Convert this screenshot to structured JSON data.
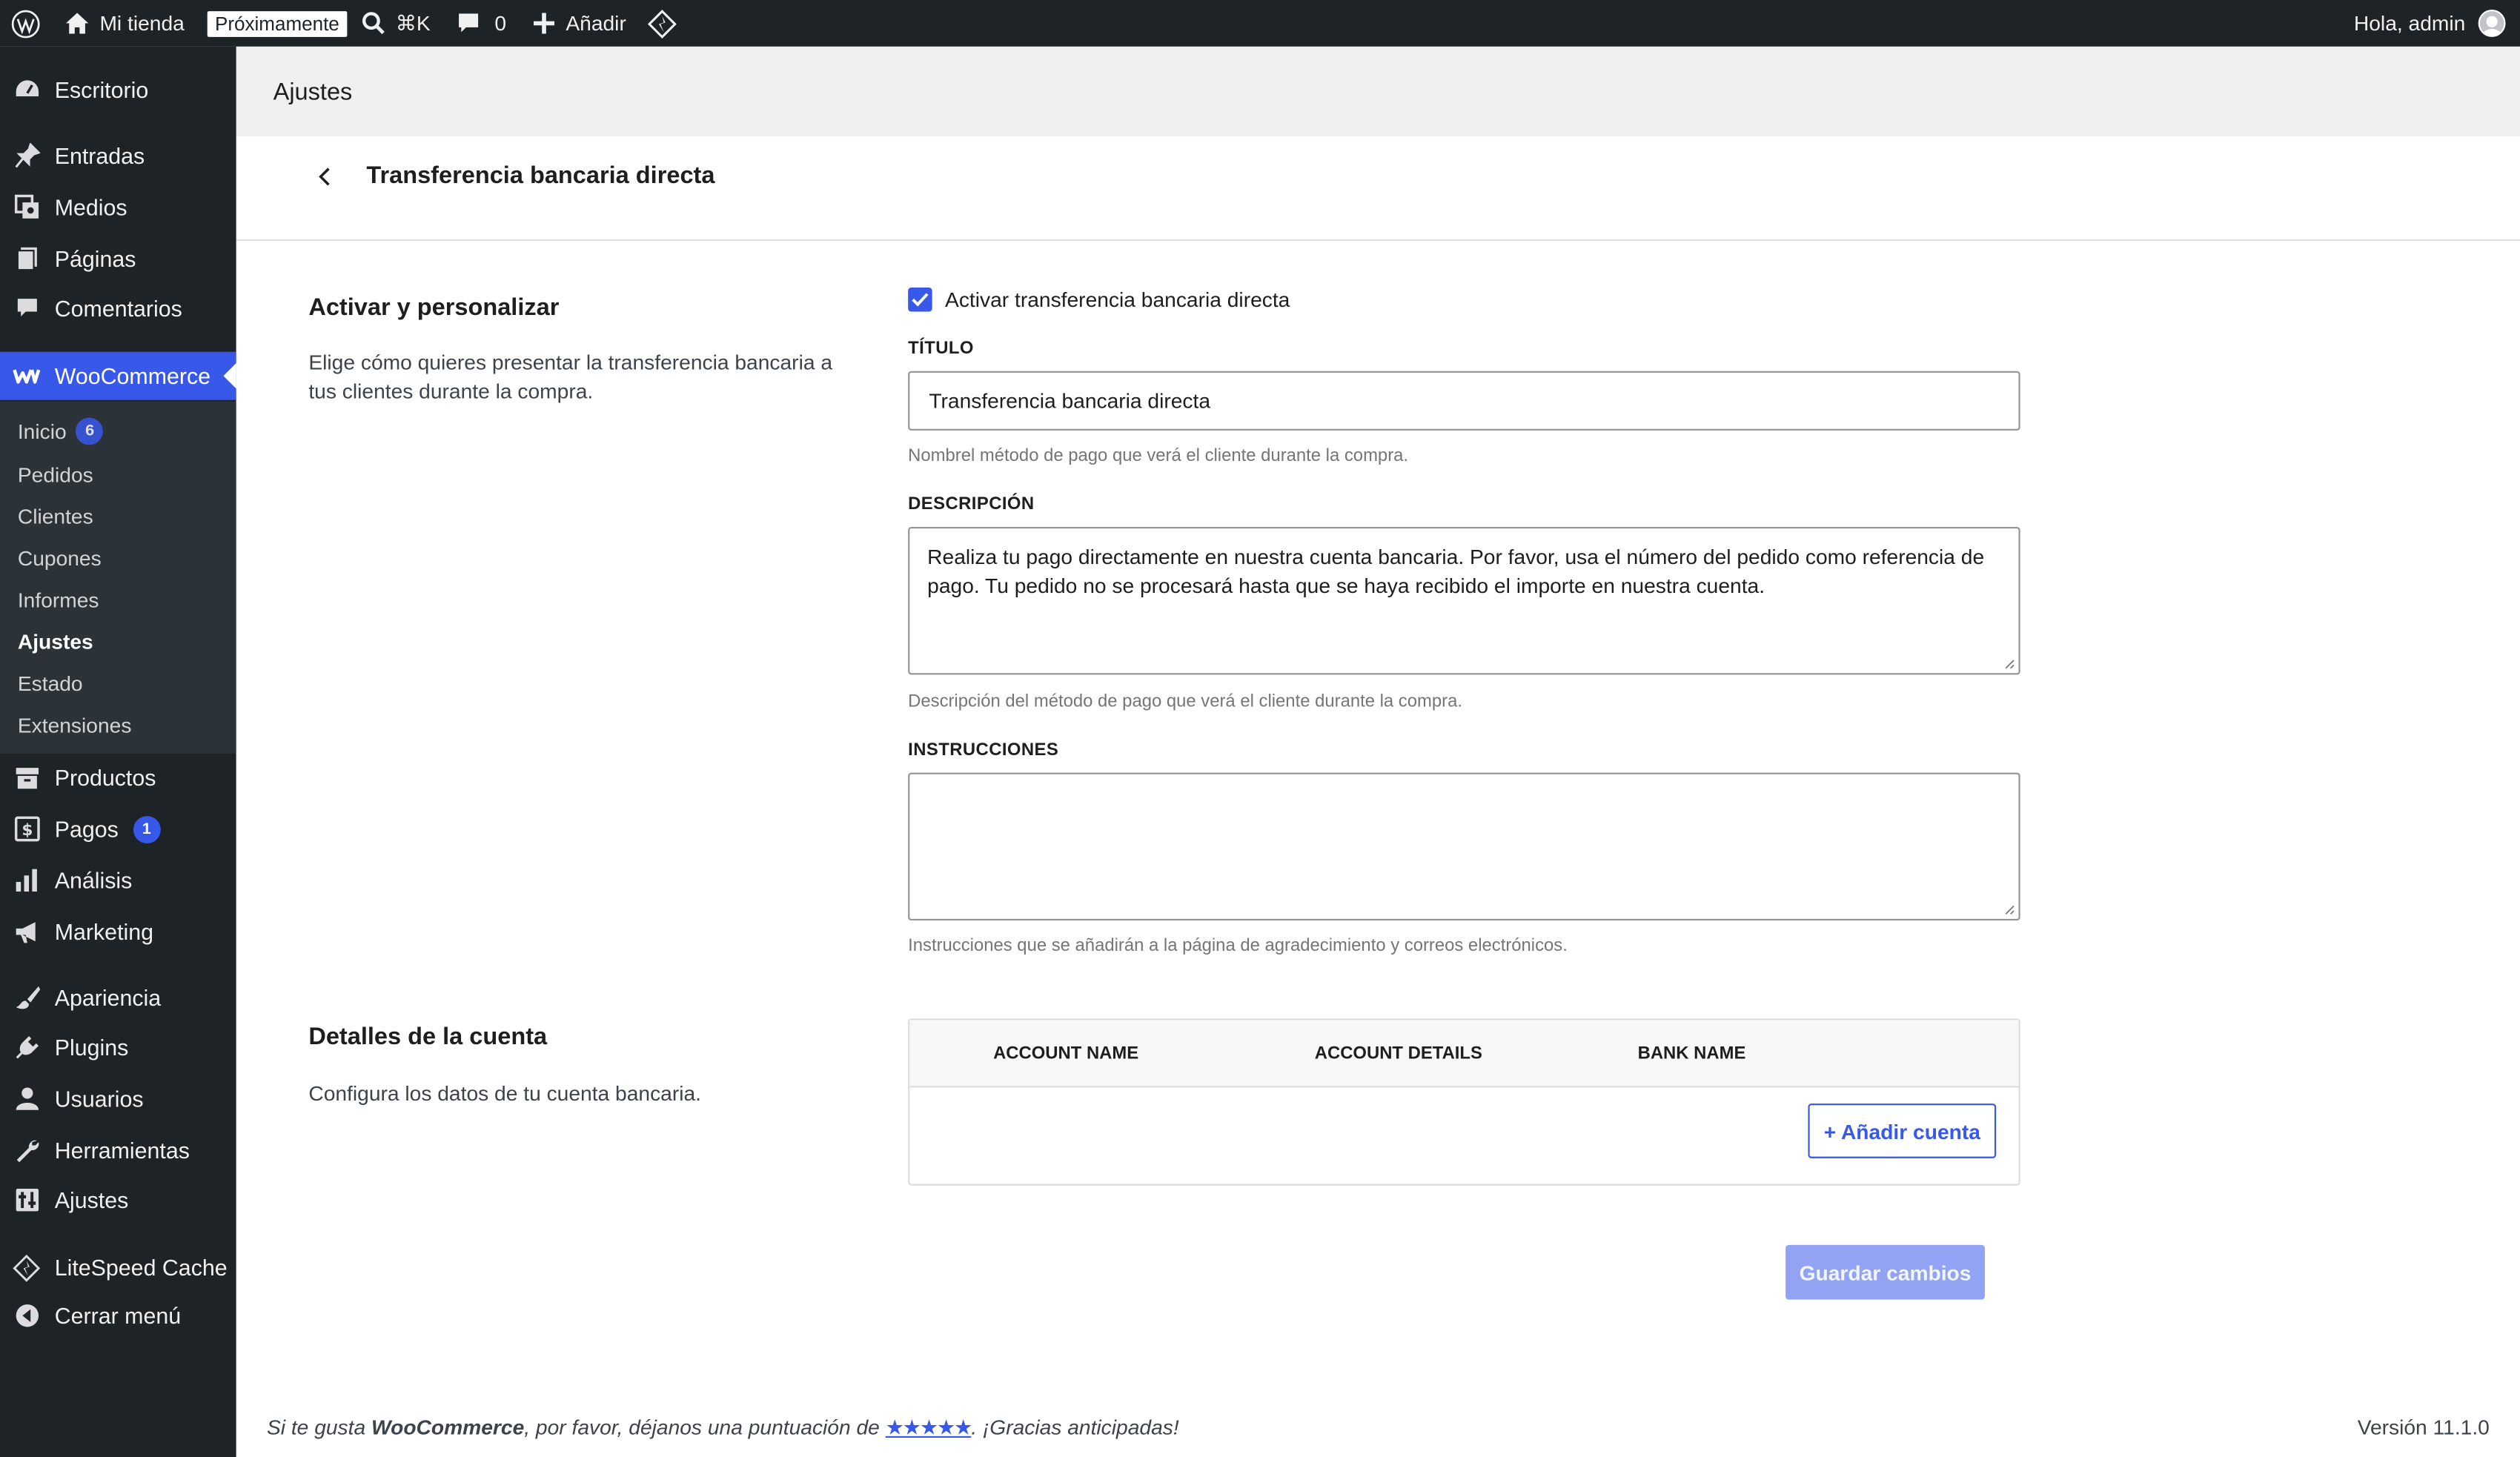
{
  "adminbar": {
    "site_name": "Mi tienda",
    "badge": "Próximamente",
    "search_shortcut": "⌘K",
    "comments_count": "0",
    "new_label": "Añadir",
    "greeting": "Hola, admin"
  },
  "sidebar": {
    "items": [
      {
        "label": "Escritorio",
        "icon": "dashboard-icon"
      },
      {
        "label": "Entradas",
        "icon": "pin-icon"
      },
      {
        "label": "Medios",
        "icon": "media-icon"
      },
      {
        "label": "Páginas",
        "icon": "pages-icon"
      },
      {
        "label": "Comentarios",
        "icon": "comments-icon"
      },
      {
        "label": "WooCommerce",
        "icon": "woocommerce-icon"
      },
      {
        "label": "Productos",
        "icon": "products-icon"
      },
      {
        "label": "Pagos",
        "icon": "payments-icon",
        "badge": "1"
      },
      {
        "label": "Análisis",
        "icon": "analytics-icon"
      },
      {
        "label": "Marketing",
        "icon": "megaphone-icon"
      },
      {
        "label": "Apariencia",
        "icon": "brush-icon"
      },
      {
        "label": "Plugins",
        "icon": "plugin-icon"
      },
      {
        "label": "Usuarios",
        "icon": "users-icon"
      },
      {
        "label": "Herramientas",
        "icon": "wrench-icon"
      },
      {
        "label": "Ajustes",
        "icon": "settings-icon"
      },
      {
        "label": "LiteSpeed Cache",
        "icon": "litespeed-icon"
      },
      {
        "label": "Cerrar menú",
        "icon": "collapse-icon"
      }
    ],
    "submenu": [
      {
        "label": "Inicio",
        "badge": "6"
      },
      {
        "label": "Pedidos"
      },
      {
        "label": "Clientes"
      },
      {
        "label": "Cupones"
      },
      {
        "label": "Informes"
      },
      {
        "label": "Ajustes",
        "current": true
      },
      {
        "label": "Estado"
      },
      {
        "label": "Extensiones"
      }
    ]
  },
  "header": {
    "title": "Ajustes",
    "subtitle": "Transferencia bancaria directa"
  },
  "section1": {
    "title": "Activar y personalizar",
    "description": "Elige cómo quieres presentar la transferencia bancaria a tus clientes durante la compra.",
    "enable_label": "Activar transferencia bancaria directa",
    "enabled": true,
    "title_label": "TÍTULO",
    "title_value": "Transferencia bancaria directa",
    "title_help": "Nombrel método de pago que verá el cliente durante la compra.",
    "desc_label": "DESCRIPCIÓN",
    "desc_value": "Realiza tu pago directamente en nuestra cuenta bancaria. Por favor, usa el número del pedido como referencia de pago. Tu pedido no se procesará hasta que se haya recibido el importe en nuestra cuenta.",
    "desc_help": "Descripción del método de pago que verá el cliente durante la compra.",
    "instr_label": "INSTRUCCIONES",
    "instr_value": "",
    "instr_help": "Instrucciones que se añadirán a la página de agradecimiento y correos electrónicos."
  },
  "section2": {
    "title": "Detalles de la cuenta",
    "description": "Configura los datos de tu cuenta bancaria.",
    "columns": [
      "ACCOUNT NAME",
      "ACCOUNT DETAILS",
      "BANK NAME"
    ],
    "add_button": "+ Añadir cuenta"
  },
  "save_button": "Guardar cambios",
  "footer": {
    "prefix": "Si te gusta ",
    "brand": "WooCommerce",
    "middle": ", por favor, déjanos una puntuación de ",
    "stars": "★★★★★",
    "suffix": ". ¡Gracias anticipadas!",
    "version": "Versión 11.1.0"
  },
  "colors": {
    "accent": "#3858e9",
    "sidebar_bg": "#1d2327",
    "submenu_bg": "#2c3338",
    "header_bg": "#f0f0f0"
  }
}
